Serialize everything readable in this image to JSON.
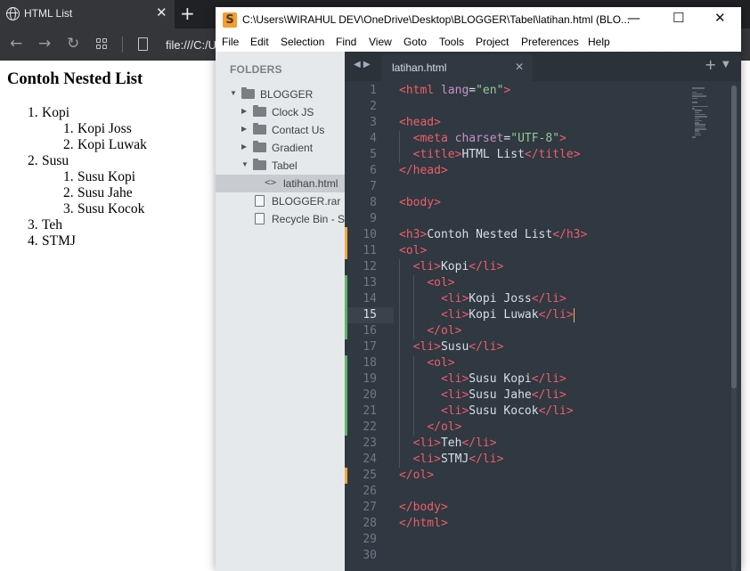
{
  "browser": {
    "tab_title": "HTML List",
    "tab_close": "✕",
    "new_tab": "+",
    "url": "file:///C:/U",
    "page": {
      "heading": "Contoh Nested List",
      "list": [
        {
          "num": "1.",
          "text": "Kopi",
          "children": [
            {
              "num": "1.",
              "text": "Kopi Joss"
            },
            {
              "num": "2.",
              "text": "Kopi Luwak"
            }
          ]
        },
        {
          "num": "2.",
          "text": "Susu",
          "children": [
            {
              "num": "1.",
              "text": "Susu Kopi"
            },
            {
              "num": "2.",
              "text": "Susu Jahe"
            },
            {
              "num": "3.",
              "text": "Susu Kocok"
            }
          ]
        },
        {
          "num": "3.",
          "text": "Teh"
        },
        {
          "num": "4.",
          "text": "STMJ"
        }
      ]
    }
  },
  "editor": {
    "window_title": "C:\\Users\\WIRAHUL DEV\\OneDrive\\Desktop\\BLOGGER\\Tabel\\latihan.html (BLO...",
    "window_buttons": {
      "minimize": "—",
      "maximize": "☐",
      "close": "✕"
    },
    "menu": [
      "File",
      "Edit",
      "Selection",
      "Find",
      "View",
      "Goto",
      "Tools",
      "Project",
      "Preferences",
      "Help"
    ],
    "sidebar": {
      "header": "FOLDERS",
      "tree": [
        {
          "label": "BLOGGER",
          "kind": "folder",
          "expanded": true,
          "depth": 0
        },
        {
          "label": "Clock JS",
          "kind": "folder",
          "expanded": false,
          "depth": 1
        },
        {
          "label": "Contact Us",
          "kind": "folder",
          "expanded": false,
          "depth": 1
        },
        {
          "label": "Gradient",
          "kind": "folder",
          "expanded": false,
          "depth": 1
        },
        {
          "label": "Tabel",
          "kind": "folder",
          "expanded": true,
          "depth": 1
        },
        {
          "label": "latihan.html",
          "kind": "code",
          "selected": true,
          "depth": 2
        },
        {
          "label": "BLOGGER.rar",
          "kind": "file",
          "depth": 1
        },
        {
          "label": "Recycle Bin - Sh",
          "kind": "file",
          "depth": 1
        }
      ]
    },
    "tab": {
      "name": "latihan.html",
      "close": "✕"
    },
    "current_line": 15,
    "lines": [
      {
        "n": 1,
        "html": "<span class='tg'>&lt;html</span> <span class='at'>lang</span>=<span class='st-str'>\"en\"</span><span class='tg'>&gt;</span>"
      },
      {
        "n": 2,
        "html": ""
      },
      {
        "n": 3,
        "html": "<span class='tg'>&lt;head&gt;</span>"
      },
      {
        "n": 4,
        "html": "  <span class='tg'>&lt;meta</span> <span class='at'>charset</span>=<span class='st-str'>\"UTF-8\"</span><span class='tg'>&gt;</span>"
      },
      {
        "n": 5,
        "html": "  <span class='tg'>&lt;title&gt;</span>HTML List<span class='tg'>&lt;/title&gt;</span>"
      },
      {
        "n": 6,
        "html": "<span class='tg'>&lt;/head&gt;</span>"
      },
      {
        "n": 7,
        "html": ""
      },
      {
        "n": 8,
        "html": "<span class='tg'>&lt;body&gt;</span>"
      },
      {
        "n": 9,
        "html": ""
      },
      {
        "n": 10,
        "html": "<span class='tg'>&lt;h3&gt;</span>Contoh Nested List<span class='tg'>&lt;/h3&gt;</span>",
        "mark": "mod"
      },
      {
        "n": 11,
        "html": "<span class='tg'>&lt;ol&gt;</span>",
        "mark": "mod"
      },
      {
        "n": 12,
        "html": "  <span class='tg'>&lt;li&gt;</span>Kopi<span class='tg'>&lt;/li&gt;</span>"
      },
      {
        "n": 13,
        "html": "    <span class='tg'>&lt;ol&gt;</span>",
        "mark": "add"
      },
      {
        "n": 14,
        "html": "      <span class='tg'>&lt;li&gt;</span>Kopi Joss<span class='tg'>&lt;/li&gt;</span>",
        "mark": "add"
      },
      {
        "n": 15,
        "html": "      <span class='tg'>&lt;li&gt;</span>Kopi Luwak<span class='tg'>&lt;/li&gt;</span><span class='cursor'></span>",
        "mark": "add"
      },
      {
        "n": 16,
        "html": "    <span class='tg'>&lt;/ol&gt;</span>",
        "mark": "add"
      },
      {
        "n": 17,
        "html": "  <span class='tg'>&lt;li&gt;</span>Susu<span class='tg'>&lt;/li&gt;</span>"
      },
      {
        "n": 18,
        "html": "    <span class='tg'>&lt;ol&gt;</span>",
        "mark": "add"
      },
      {
        "n": 19,
        "html": "      <span class='tg'>&lt;li&gt;</span>Susu Kopi<span class='tg'>&lt;/li&gt;</span>",
        "mark": "add"
      },
      {
        "n": 20,
        "html": "      <span class='tg'>&lt;li&gt;</span>Susu Jahe<span class='tg'>&lt;/li&gt;</span>",
        "mark": "add"
      },
      {
        "n": 21,
        "html": "      <span class='tg'>&lt;li&gt;</span>Susu Kocok<span class='tg'>&lt;/li&gt;</span>",
        "mark": "add"
      },
      {
        "n": 22,
        "html": "    <span class='tg'>&lt;/ol&gt;</span>",
        "mark": "add"
      },
      {
        "n": 23,
        "html": "  <span class='tg'>&lt;li&gt;</span>Teh<span class='tg'>&lt;/li&gt;</span>"
      },
      {
        "n": 24,
        "html": "  <span class='tg'>&lt;li&gt;</span>STMJ<span class='tg'>&lt;/li&gt;</span>"
      },
      {
        "n": 25,
        "html": "<span class='tg'>&lt;/ol&gt;</span>",
        "mark": "mod"
      },
      {
        "n": 26,
        "html": ""
      },
      {
        "n": 27,
        "html": "<span class='tg'>&lt;/body&gt;</span>"
      },
      {
        "n": 28,
        "html": "<span class='tg'>&lt;/html&gt;</span>"
      },
      {
        "n": 29,
        "html": ""
      },
      {
        "n": 30,
        "html": ""
      }
    ]
  }
}
